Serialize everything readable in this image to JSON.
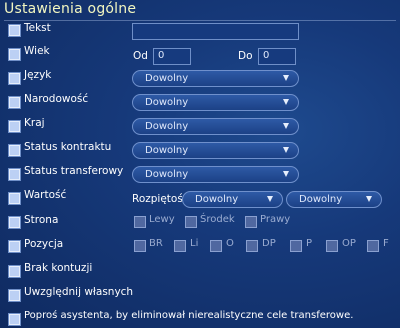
{
  "title": "Ustawienia ogólne",
  "text_field": {
    "label": "Tekst",
    "value": ""
  },
  "age": {
    "label": "Wiek",
    "from_label": "Od",
    "from_value": "0",
    "to_label": "Do",
    "to_value": "0"
  },
  "language": {
    "label": "Język",
    "value": "Dowolny"
  },
  "nationality": {
    "label": "Narodowość",
    "value": "Dowolny"
  },
  "country": {
    "label": "Kraj",
    "value": "Dowolny"
  },
  "contract_status": {
    "label": "Status kontraktu",
    "value": "Dowolny"
  },
  "transfer_status": {
    "label": "Status transferowy",
    "value": "Dowolny"
  },
  "value": {
    "label": "Wartość",
    "range_label": "Rozpiętość",
    "from": "Dowolny",
    "to": "Dowolny"
  },
  "side": {
    "label": "Strona",
    "options": [
      "Lewy",
      "Środek",
      "Prawy"
    ]
  },
  "position": {
    "label": "Pozycja",
    "options": [
      "BR",
      "Li",
      "O",
      "DP",
      "P",
      "OP",
      "F"
    ]
  },
  "no_injuries": {
    "label": "Brak kontuzji"
  },
  "include_own": {
    "label": "Uwzględnij własnych"
  },
  "assistant": {
    "label": "Poproś asystenta, by eliminował nierealistyczne cele transferowe."
  }
}
